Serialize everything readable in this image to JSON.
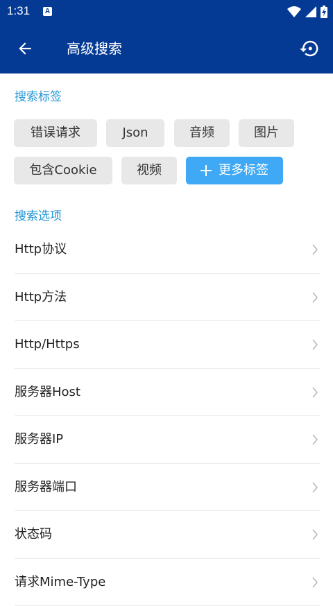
{
  "status_bar": {
    "time": "1:31",
    "notification_icon": "a-box-icon",
    "icons": [
      "wifi-icon",
      "signal-icon",
      "battery-charging-icon"
    ]
  },
  "app_bar": {
    "title": "高级搜索",
    "back_icon": "arrow-left-icon",
    "history_icon": "restore-icon",
    "color": "#053a94"
  },
  "tags_section": {
    "title": "搜索标签",
    "chips": [
      "错误请求",
      "Json",
      "音频",
      "图片",
      "包含Cookie",
      "视频"
    ],
    "more_button": "更多标签",
    "more_icon": "plus-icon",
    "accent": "#3fa9f5"
  },
  "options_section": {
    "title": "搜索选项",
    "items": [
      "Http协议",
      "Http方法",
      "Http/Https",
      "服务器Host",
      "服务器IP",
      "服务器端口",
      "状态码",
      "请求Mime-Type"
    ],
    "chevron_icon": "chevron-right-icon"
  }
}
